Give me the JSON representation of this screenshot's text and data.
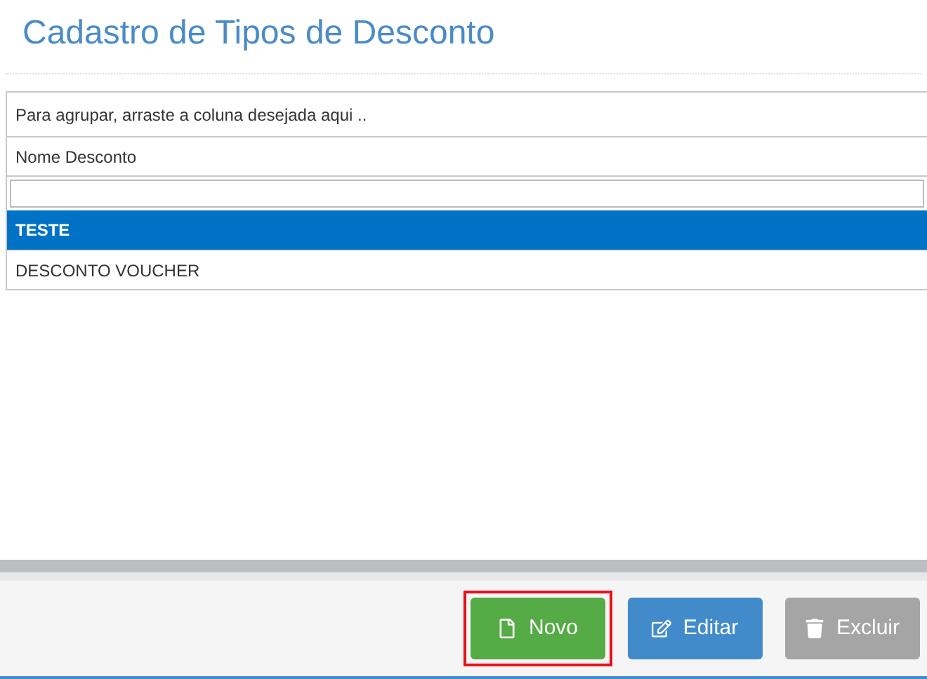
{
  "title": "Cadastro de Tipos de Desconto",
  "grid": {
    "group_hint": "Para agrupar, arraste a coluna desejada aqui ..",
    "columns": [
      "Nome Desconto"
    ],
    "rows": [
      {
        "name": "TESTE",
        "selected": true
      },
      {
        "name": "DESCONTO VOUCHER",
        "selected": false
      }
    ]
  },
  "buttons": [
    {
      "label": "Novo",
      "kind": "new",
      "highlighted": true
    },
    {
      "label": "Editar",
      "kind": "edit",
      "highlighted": false
    },
    {
      "label": "Excluir",
      "kind": "delete",
      "highlighted": false
    }
  ]
}
